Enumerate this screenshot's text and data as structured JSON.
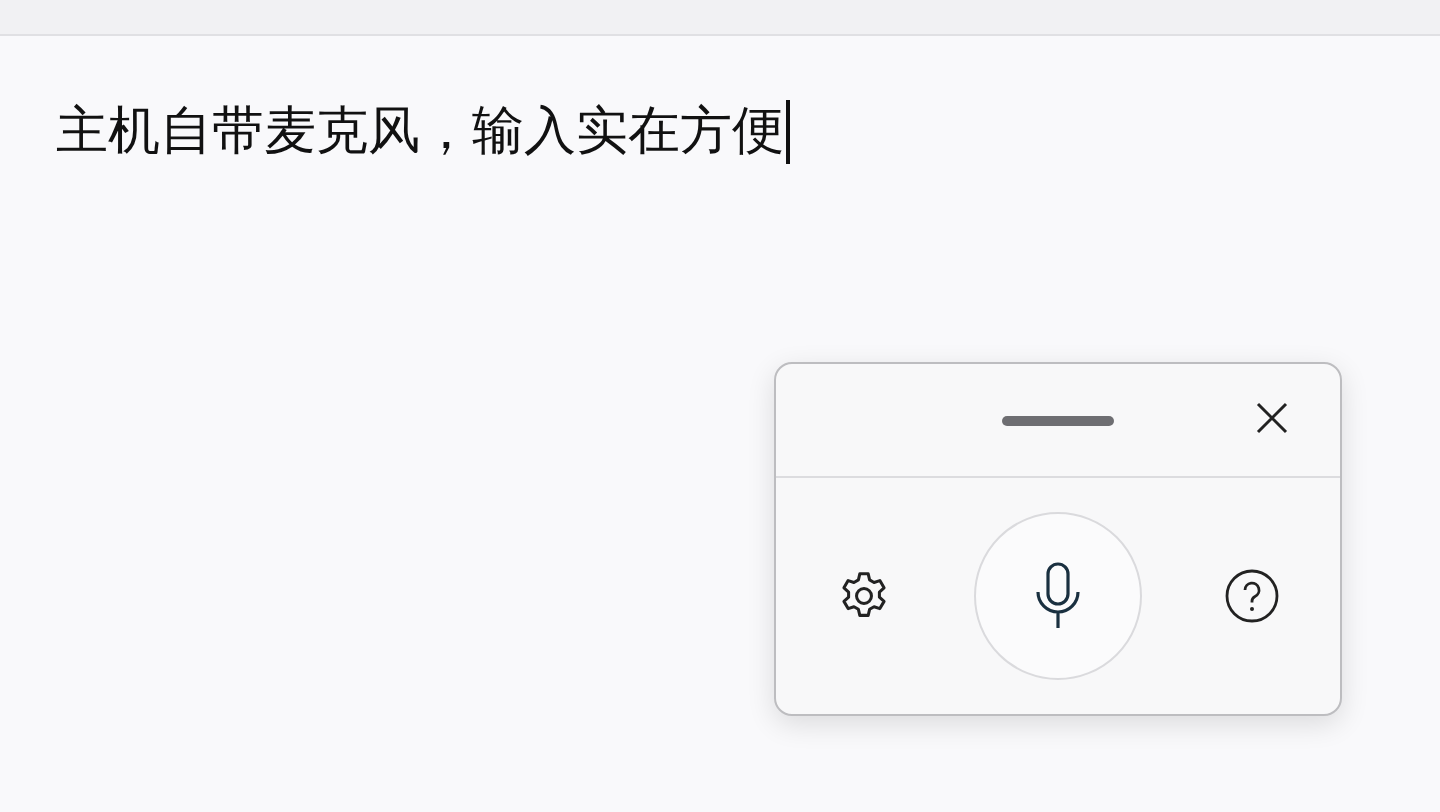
{
  "document": {
    "text": "主机自带麦克风，输入实在方便"
  },
  "voice_panel": {
    "listening": false
  }
}
